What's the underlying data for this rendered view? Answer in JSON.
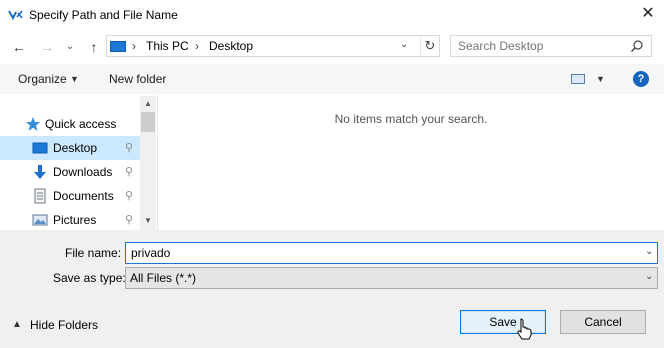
{
  "window": {
    "title": "Specify Path and File Name",
    "close": "✕"
  },
  "nav": {
    "back": "←",
    "forward": "→",
    "recent": "⌄",
    "up": "↑",
    "breadcrumb": [
      "This PC",
      "Desktop"
    ],
    "separator": "›",
    "refresh": "↻",
    "search_placeholder": "Search Desktop"
  },
  "toolbar": {
    "organize_label": "Organize",
    "new_folder_label": "New folder",
    "help": "?"
  },
  "sidebar": {
    "items": [
      {
        "label": "Quick access",
        "icon": "star-icon",
        "pinned": false
      },
      {
        "label": "Desktop",
        "icon": "desktop-icon",
        "pinned": true,
        "selected": true
      },
      {
        "label": "Downloads",
        "icon": "download-arrow-icon",
        "pinned": true
      },
      {
        "label": "Documents",
        "icon": "documents-icon",
        "pinned": true
      },
      {
        "label": "Pictures",
        "icon": "pictures-icon",
        "pinned": true
      }
    ],
    "pin_glyph": "📌"
  },
  "content": {
    "empty_message": "No items match your search."
  },
  "form": {
    "file_name_label": "File name:",
    "file_name_value": "privado",
    "save_type_label": "Save as type:",
    "save_type_value": "All Files (*.*)"
  },
  "footer": {
    "hide_folders_label": "Hide Folders",
    "save_label": "Save",
    "cancel_label": "Cancel"
  },
  "colors": {
    "accent": "#0078d7",
    "selected_bg": "#cce8ff",
    "help_bg": "#1565c0",
    "footer_bg": "#f0f0f0"
  }
}
